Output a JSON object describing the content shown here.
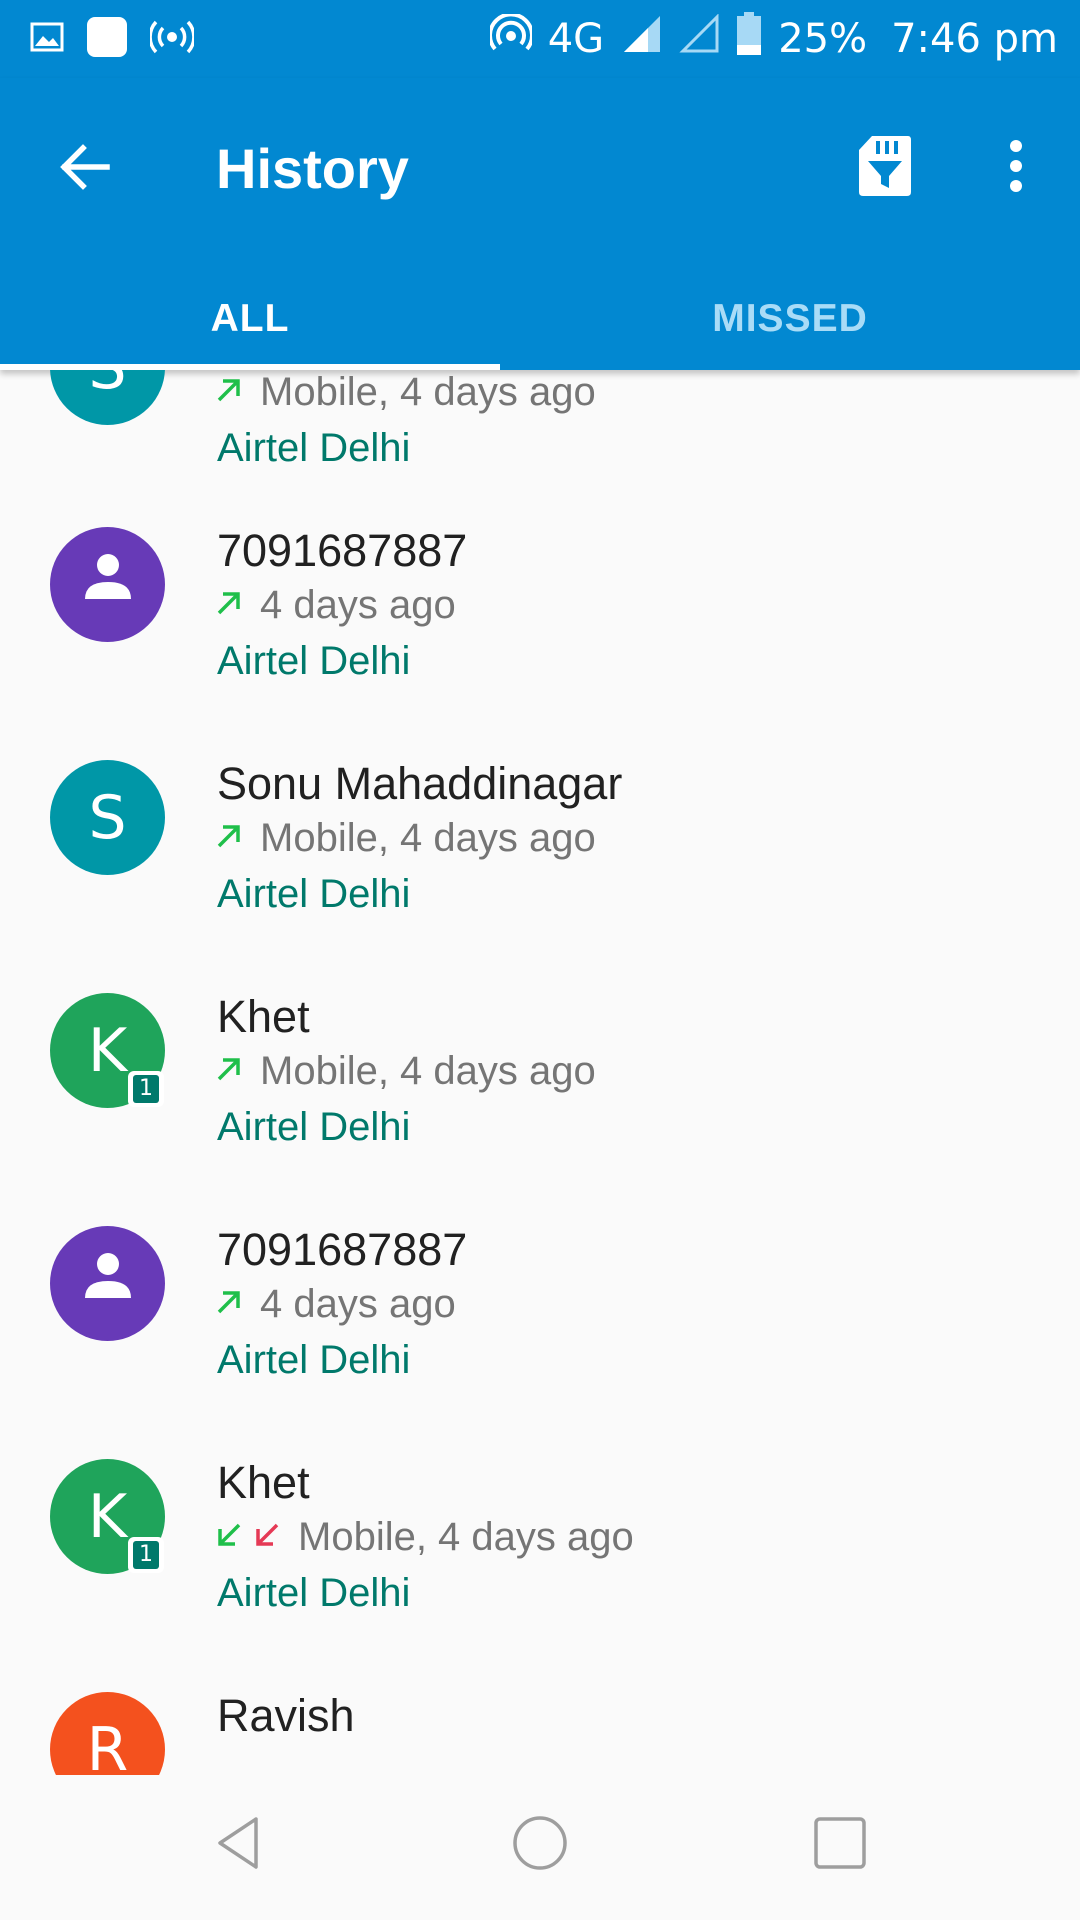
{
  "status_bar": {
    "network_type": "4G",
    "battery_percent": "25%",
    "time": "7:46 pm"
  },
  "app_bar": {
    "title": "History"
  },
  "tabs": [
    {
      "label": "ALL",
      "selected": true
    },
    {
      "label": "MISSED",
      "selected": false
    }
  ],
  "calls": [
    {
      "name": "",
      "initial": "S",
      "avatar_color": "#0097a7",
      "avatar_type": "letter",
      "sim": "",
      "call_types": [
        "outgoing"
      ],
      "detail": "Mobile, 4 days ago",
      "carrier": "Airtel Delhi"
    },
    {
      "name": "7091687887",
      "initial": "",
      "avatar_color": "#673ab7",
      "avatar_type": "person",
      "sim": "",
      "call_types": [
        "outgoing"
      ],
      "detail": "4 days ago",
      "carrier": "Airtel Delhi"
    },
    {
      "name": "Sonu Mahaddinagar",
      "initial": "S",
      "avatar_color": "#0097a7",
      "avatar_type": "letter",
      "sim": "",
      "call_types": [
        "outgoing"
      ],
      "detail": "Mobile, 4 days ago",
      "carrier": "Airtel Delhi"
    },
    {
      "name": "Khet",
      "initial": "K",
      "avatar_color": "#1fa45b",
      "avatar_type": "letter",
      "sim": "1",
      "call_types": [
        "outgoing"
      ],
      "detail": "Mobile, 4 days ago",
      "carrier": "Airtel Delhi"
    },
    {
      "name": "7091687887",
      "initial": "",
      "avatar_color": "#673ab7",
      "avatar_type": "person",
      "sim": "",
      "call_types": [
        "outgoing"
      ],
      "detail": "4 days ago",
      "carrier": "Airtel Delhi"
    },
    {
      "name": "Khet",
      "initial": "K",
      "avatar_color": "#1fa45b",
      "avatar_type": "letter",
      "sim": "1",
      "call_types": [
        "incoming",
        "missed"
      ],
      "detail": "Mobile, 4 days ago",
      "carrier": "Airtel Delhi"
    },
    {
      "name": "Ravish",
      "initial": "R",
      "avatar_color": "#f4511e",
      "avatar_type": "letter",
      "sim": "",
      "call_types": [],
      "detail": "",
      "carrier": ""
    }
  ],
  "colors": {
    "primary": "#0288d1",
    "carrier_text": "#00796b",
    "outgoing_arrow": "#1fbf4a",
    "incoming_arrow": "#1fbf4a",
    "missed_arrow": "#e53955"
  },
  "icons": {
    "status_left": [
      "gallery-icon",
      "app-notification-icon",
      "hotspot-broadcast-icon"
    ],
    "status_right": [
      "wifi-hotspot-icon",
      "signal-4g-icon",
      "signal-empty-icon",
      "battery-icon"
    ],
    "app_bar": [
      "back-arrow-icon",
      "sd-card-filter-icon",
      "more-vert-icon"
    ],
    "nav": [
      "back-triangle-icon",
      "home-circle-icon",
      "recents-square-icon"
    ]
  }
}
